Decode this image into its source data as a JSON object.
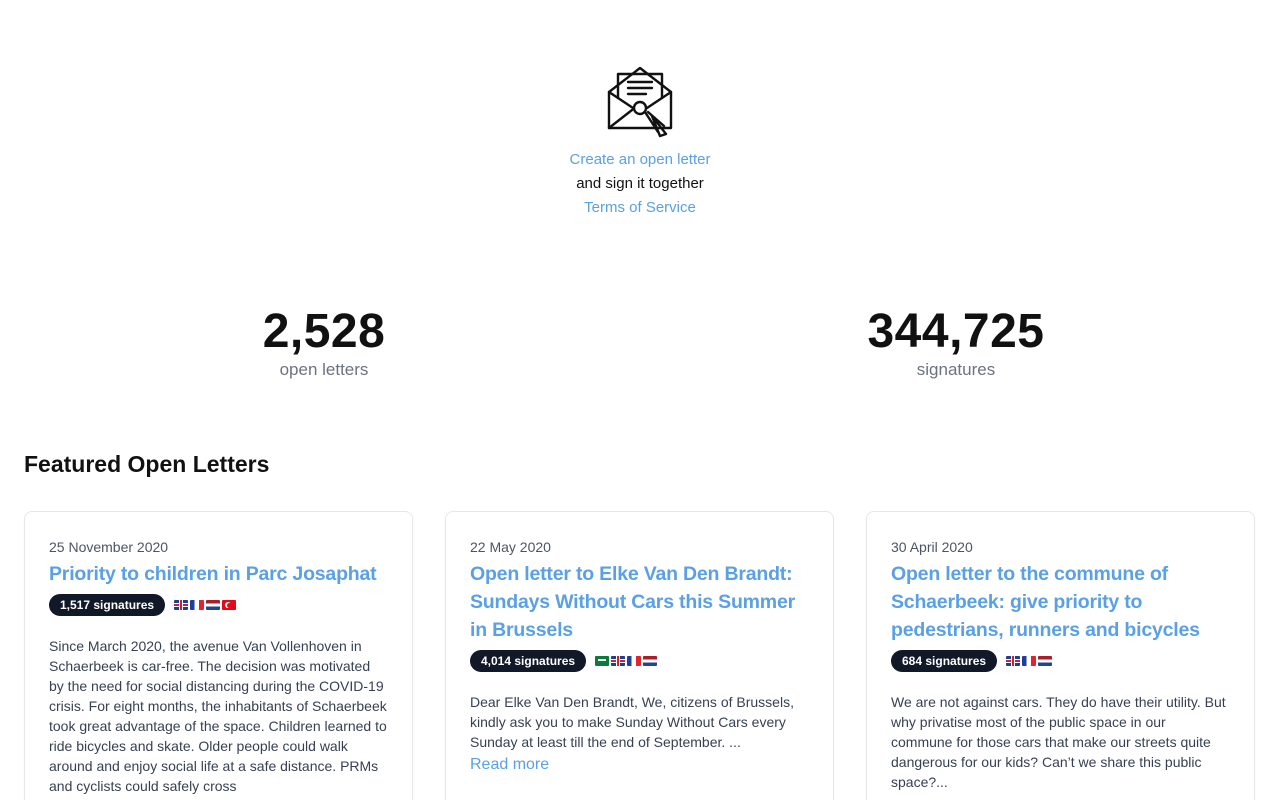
{
  "hero": {
    "create_link": "Create an open letter",
    "subtitle": "and sign it together",
    "terms_link": "Terms of Service"
  },
  "stats": {
    "letters_count": "2,528",
    "letters_label": "open letters",
    "signatures_count": "344,725",
    "signatures_label": "signatures"
  },
  "featured": {
    "title": "Featured Open Letters",
    "cards": [
      {
        "date": "25 November 2020",
        "title": "Priority to children in Parc Josaphat",
        "signatures": "1,517 signatures",
        "flags": [
          "gb",
          "fr",
          "nl",
          "tr"
        ],
        "body": "Since March 2020, the avenue Van Vollenhoven in Schaerbeek is car-free. The decision was motivated by the need for social distancing during the COVID-19 crisis. For eight months, the inhabitants of Schaerbeek took great advantage of the space. Children learned to ride bicycles and skate. Older people could walk around and enjoy social life at a safe distance. PRMs and cyclists could safely cross"
      },
      {
        "date": "22 May 2020",
        "title": "Open letter to Elke Van Den Brandt: Sundays Without Cars this Summer in Brussels",
        "signatures": "4,014 signatures",
        "flags": [
          "sa",
          "gb",
          "fr",
          "nl"
        ],
        "body": "Dear Elke Van Den Brandt, We, citizens of Brussels, kindly ask you to make Sunday Without Cars every Sunday at least till the end of September. ...",
        "read_more": "Read more"
      },
      {
        "date": "30 April 2020",
        "title": "Open letter to the commune of Schaerbeek: give priority to pedestrians, runners and bicycles",
        "signatures": "684 signatures",
        "flags": [
          "gb",
          "fr",
          "nl"
        ],
        "body": "We are not against cars. They do have their utility. But why privatise most of the public space in our commune for those cars that make our streets quite dangerous for our kids? Can’t we share this public space?..."
      }
    ]
  }
}
